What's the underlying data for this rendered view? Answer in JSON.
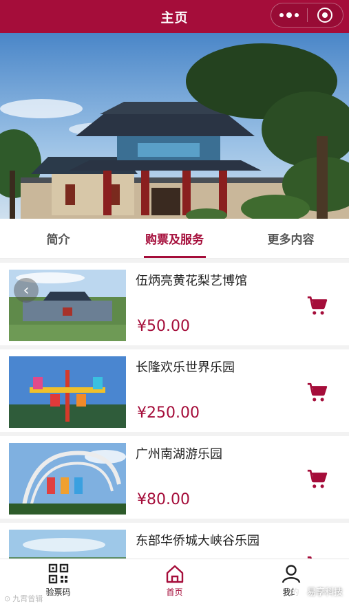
{
  "header": {
    "title": "主页",
    "more_icon": "more-dots-icon",
    "close_icon": "target-icon",
    "color": "#a50d3a"
  },
  "banner": {
    "description_icon": "temple-gate-image"
  },
  "tabs": [
    {
      "label": "简介",
      "active": false
    },
    {
      "label": "购票及服务",
      "active": true
    },
    {
      "label": "更多内容",
      "active": false
    }
  ],
  "items": [
    {
      "name": "伍炳亮黄花梨艺博馆",
      "price": "¥50.00"
    },
    {
      "name": "长隆欢乐世界乐园",
      "price": "¥250.00"
    },
    {
      "name": "广州南湖游乐园",
      "price": "¥80.00"
    },
    {
      "name": "东部华侨城大峡谷乐园",
      "price": ""
    }
  ],
  "nav": [
    {
      "label": "验票码",
      "icon": "qr-code-icon"
    },
    {
      "label": "首页",
      "icon": "home-icon"
    },
    {
      "label": "我的",
      "icon": "user-icon"
    }
  ],
  "watermarks": {
    "left": "九霄曾辑",
    "right": "易享科技"
  }
}
